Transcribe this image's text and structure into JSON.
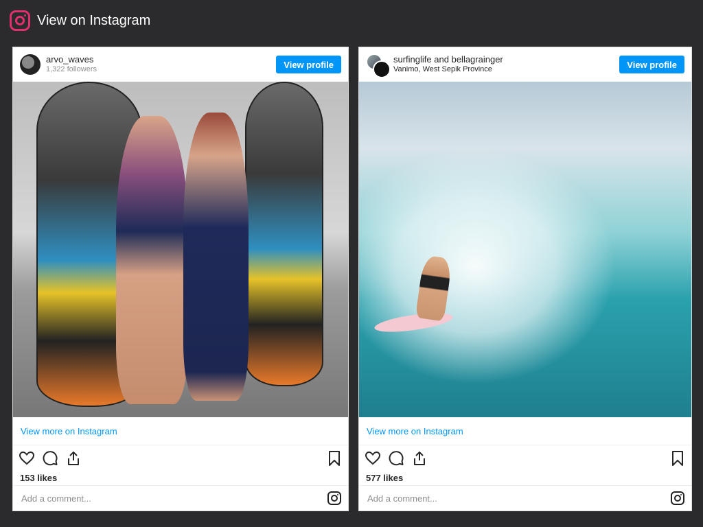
{
  "header": {
    "title": "View on Instagram",
    "logo_icon": "instagram-icon"
  },
  "posts": [
    {
      "username": "arvo_waves",
      "subline": "1,322 followers",
      "view_profile_label": "View profile",
      "view_more_label": "View more on Instagram",
      "likes": "153 likes",
      "comment_placeholder": "Add a comment..."
    },
    {
      "user1": "surfinglife",
      "and": "and",
      "user2": "bellagrainger",
      "subline": "Vanimo, West Sepik Province",
      "view_profile_label": "View profile",
      "view_more_label": "View more on Instagram",
      "likes": "577 likes",
      "comment_placeholder": "Add a comment..."
    }
  ],
  "colors": {
    "accent": "#0095f6",
    "brand": "#e1306c",
    "page_bg": "#2b2b2d"
  }
}
